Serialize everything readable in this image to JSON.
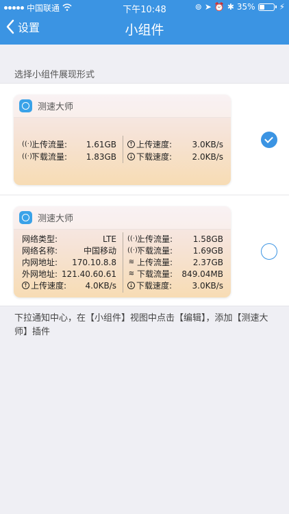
{
  "status_bar": {
    "carrier": "中国联通",
    "time": "下午10:48",
    "battery_percent": "35%"
  },
  "nav": {
    "back_label": "设置",
    "title": "小组件"
  },
  "section_label": "选择小组件展现形式",
  "widget_compact": {
    "app_name": "测速大师",
    "selected": true,
    "left": [
      {
        "label": "上传流量:",
        "value": "1.61GB",
        "icon": "antenna-icon"
      },
      {
        "label": "下载流量:",
        "value": "1.83GB",
        "icon": "antenna-icon"
      }
    ],
    "right": [
      {
        "label": "上传速度:",
        "value": "3.0KB/s",
        "icon": "upload-circle-icon"
      },
      {
        "label": "下载速度:",
        "value": "2.0KB/s",
        "icon": "download-circle-icon"
      }
    ]
  },
  "widget_detailed": {
    "app_name": "测速大师",
    "selected": false,
    "left": [
      {
        "label": "网络类型:",
        "value": "LTE"
      },
      {
        "label": "网络名称:",
        "value": "中国移动"
      },
      {
        "label": "内网地址:",
        "value": "170.10.8.8"
      },
      {
        "label": "外网地址:",
        "value": "121.40.60.61"
      },
      {
        "label": "上传速度:",
        "value": "4.0KB/s",
        "icon": "upload-circle-icon"
      }
    ],
    "right": [
      {
        "label": "上传流量:",
        "value": "1.58GB",
        "icon": "antenna-icon"
      },
      {
        "label": "下载流量:",
        "value": "1.69GB",
        "icon": "antenna-icon"
      },
      {
        "label": "上传流量:",
        "value": "2.37GB",
        "icon": "wifi-icon"
      },
      {
        "label": "下载流量:",
        "value": "849.04MB",
        "icon": "wifi-icon"
      },
      {
        "label": "下载速度:",
        "value": "3.0KB/s",
        "icon": "download-circle-icon"
      }
    ]
  },
  "footer_text": "下拉通知中心，在【小组件】视图中点击【编辑】，添加【测速大师】插件",
  "colors": {
    "nav_blue": "#3b94e3",
    "background": "#efeff4"
  }
}
